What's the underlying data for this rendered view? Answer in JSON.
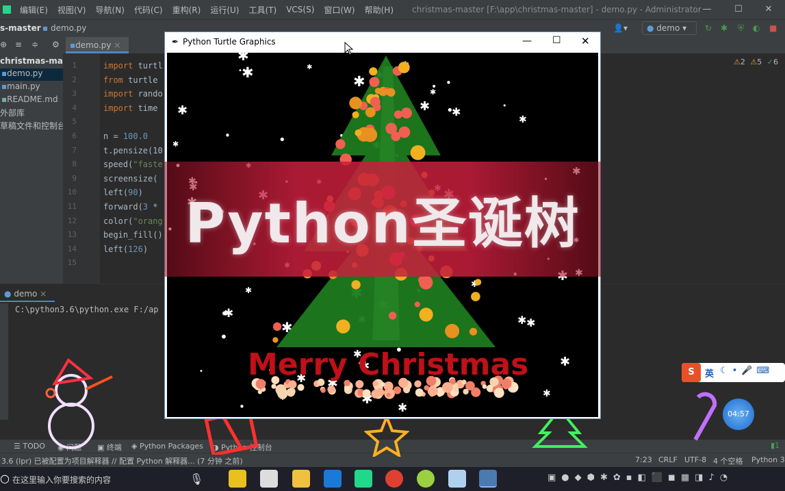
{
  "menu": [
    "编辑(E)",
    "视图(V)",
    "导航(N)",
    "代码(C)",
    "重构(R)",
    "运行(U)",
    "工具(T)",
    "VCS(S)",
    "窗口(W)",
    "帮助(H)"
  ],
  "window_title": "christmas-master [F:\\app\\christmas-master] - demo.py - Administrator",
  "nav": {
    "project": "s-master",
    "file": "demo.py",
    "run_config": "demo"
  },
  "project_tree": {
    "root": "christmas-maste",
    "files": [
      "demo.py",
      "main.py",
      "README.md"
    ],
    "ext_lib": "外部库",
    "scratch": "草稿文件和控制台"
  },
  "editor": {
    "tab": "demo.py",
    "inspections": {
      "warnings": "2",
      "weak": "5",
      "typos": "6"
    },
    "line_numbers": [
      "1",
      "2",
      "3",
      "4",
      "5",
      "6",
      "7",
      "8",
      "9",
      "10",
      "11",
      "12",
      "13",
      "14",
      "15"
    ],
    "lines": [
      {
        "kw": "import",
        "rest": " turtl"
      },
      {
        "kw": "from",
        "rest": " turtle"
      },
      {
        "kw": "import",
        "rest": " rando"
      },
      {
        "kw": "import",
        "rest": " time"
      },
      {
        "kw": "",
        "rest": ""
      },
      {
        "kw": "",
        "rest": "n = ",
        "num": "100.0"
      },
      {
        "kw": "",
        "rest": "t.pensize(10"
      },
      {
        "kw": "",
        "rest": "speed(",
        "str": "\"faste"
      },
      {
        "kw": "",
        "rest": "screensize("
      },
      {
        "kw": "",
        "rest": "left(",
        "num": "90",
        "tail": ")"
      },
      {
        "kw": "",
        "rest": "forward(",
        "num": "3",
        "tail": " *"
      },
      {
        "kw": "",
        "rest": "color(",
        "str": "\"orang"
      },
      {
        "kw": "",
        "rest": "begin_fill()"
      },
      {
        "kw": "",
        "rest": "left(",
        "num": "126",
        "tail": ")"
      },
      {
        "kw": "",
        "rest": ""
      }
    ]
  },
  "run": {
    "tab": "demo",
    "output": "C:\\python3.6\\python.exe F:/ap"
  },
  "status": {
    "tools": [
      "TODO",
      "问题",
      "终端",
      "Python Packages",
      "Python 控制台"
    ],
    "message": "3.6 (lpr) 已被配置为项目解释器 // 配置 Python 解释器... (7 分钟 之前)",
    "position": "7:23",
    "line_sep": "CRLF",
    "encoding": "UTF-8",
    "indent": "4 个空格",
    "interpreter": "Python 3."
  },
  "taskbar": {
    "search_placeholder": "在这里输入你要搜索的内容"
  },
  "turtle_window": {
    "title": "Python Turtle Graphics",
    "greeting": "Merry Christmas"
  },
  "banner": {
    "text": "Python圣诞树"
  },
  "ime": {
    "mode": "英"
  },
  "timer": {
    "value": "04:57"
  },
  "colors": {
    "tree_green": "#1d7a1d",
    "ornament_red": "#f06050",
    "ornament_yellow": "#f0b020",
    "trunk_orange": "#e89020",
    "banner_red": "#c8203c"
  }
}
